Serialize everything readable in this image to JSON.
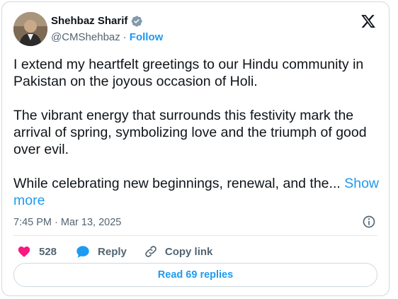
{
  "author": {
    "name": "Shehbaz Sharif",
    "handle": "@CMShehbaz",
    "separator": "·",
    "follow_label": "Follow"
  },
  "tweet": {
    "paragraph_1": "I extend my heartfelt greetings to our Hindu community in Pakistan on the joyous occasion of Holi.",
    "paragraph_2": "The vibrant energy that surrounds this festivity mark the arrival of spring, symbolizing love and the triumph of good over evil.",
    "paragraph_3": "While celebrating new beginnings, renewal, and the...",
    "show_more_label": "Show more",
    "timestamp": "7:45 PM · Mar 13, 2025"
  },
  "actions": {
    "like_count": "528",
    "reply_label": "Reply",
    "copy_link_label": "Copy link"
  },
  "replies_button": "Read 69 replies",
  "icons": {
    "verified": "verified-badge-icon",
    "x_logo": "x-logo-icon",
    "info": "info-icon",
    "like": "heart-icon",
    "reply": "speech-bubble-icon",
    "copy": "link-icon"
  },
  "colors": {
    "accent": "#1d9bf0",
    "like": "#f91880",
    "text": "#0f1419",
    "secondary": "#536471"
  }
}
